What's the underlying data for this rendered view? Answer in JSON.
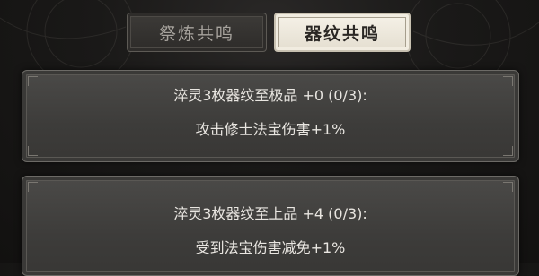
{
  "tabs": {
    "refining_resonance": "祭炼共鸣",
    "pattern_resonance": "器纹共鸣",
    "active": "pattern_resonance"
  },
  "resonance_list": [
    {
      "requirement": "淬灵3枚器纹至极品 +0 (0/3):",
      "effect": "攻击修士法宝伤害+1%"
    },
    {
      "requirement": "淬灵3枚器纹至上品 +4 (0/3):",
      "effect": "受到法宝伤害减免+1%"
    }
  ],
  "colors": {
    "card_bg": "#434240",
    "text": "#e9e6e1",
    "active_tab_bg": "#f1ece0",
    "inactive_tab_bg": "#353331"
  }
}
